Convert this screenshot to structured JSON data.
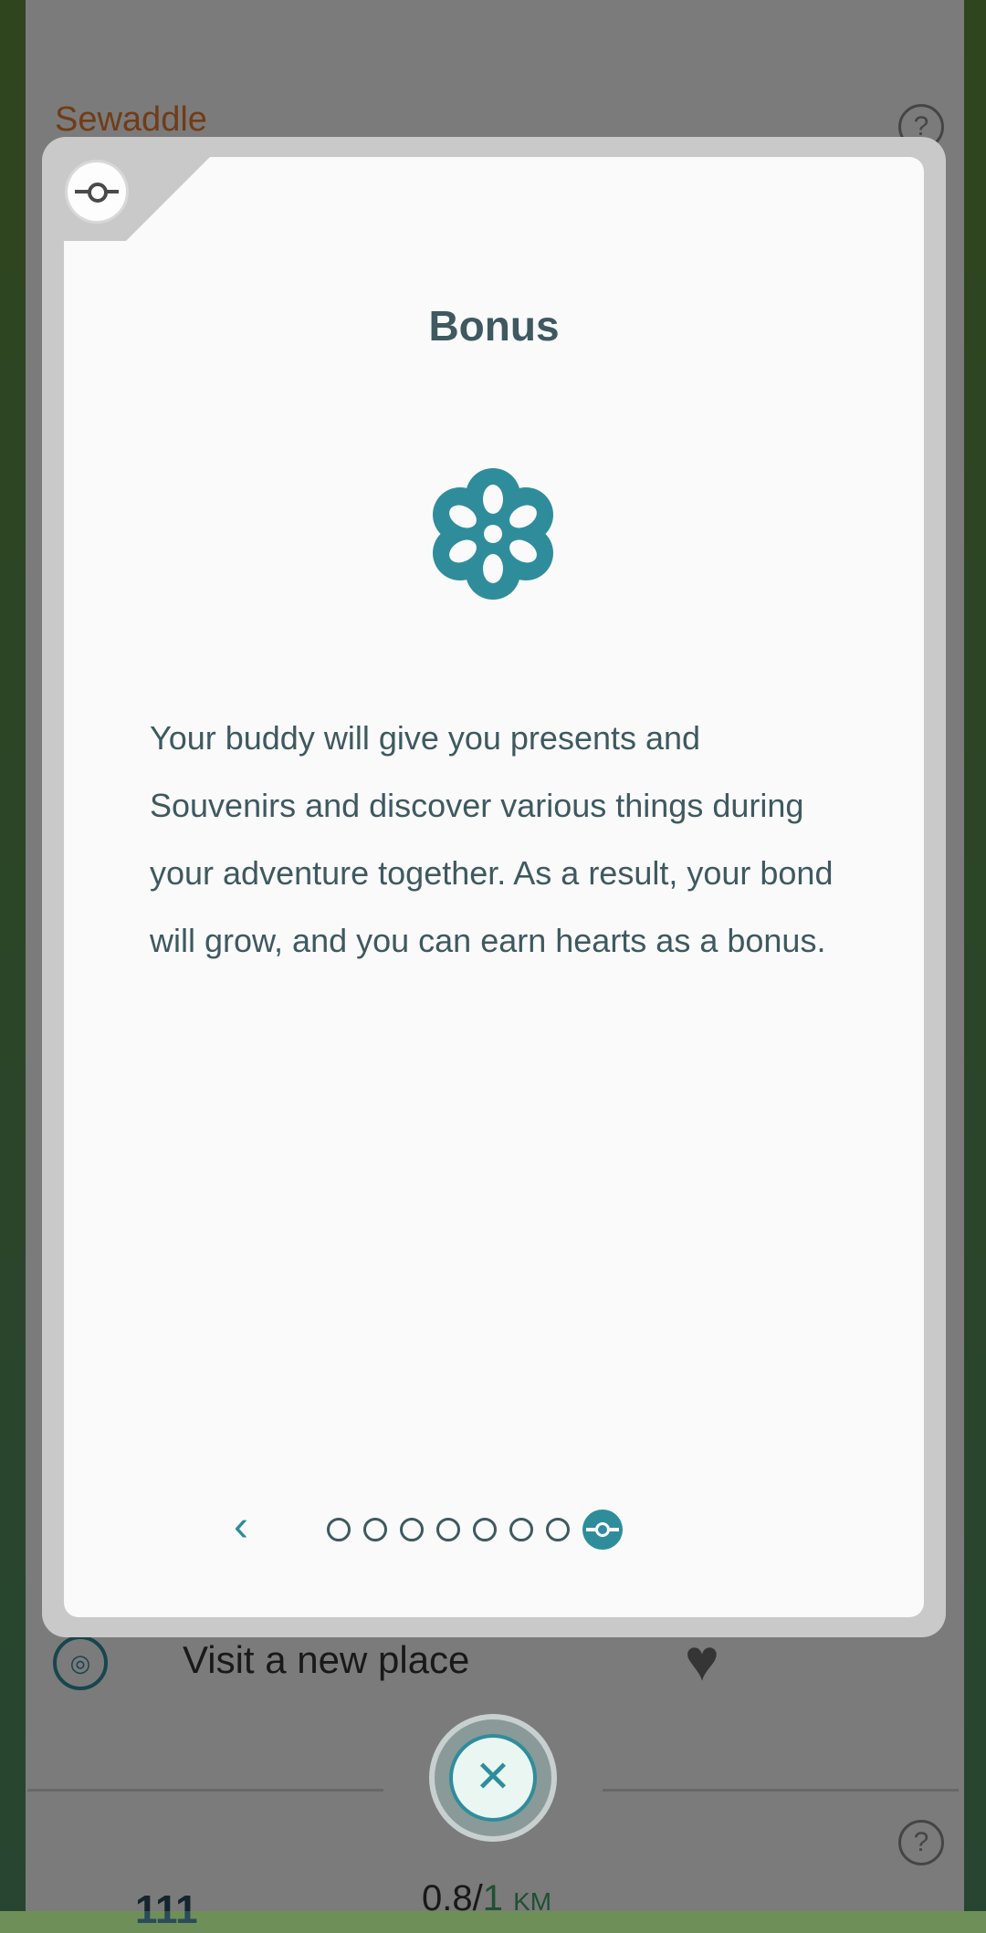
{
  "background": {
    "pokemon_name": "Sewaddle",
    "help_glyph": "?",
    "row_label": "Visit a new place",
    "heart_glyph": "♥",
    "row_icon_glyph": "◎",
    "distance_left": "111",
    "distance_walked": "0.8",
    "distance_slash": "/",
    "distance_goal": "1",
    "distance_unit": "KM"
  },
  "modal": {
    "title": "Bonus",
    "body": "Your buddy will give you presents and Souvenirs and discover various things during your adventure together. As a result, your bond will grow, and you can earn hearts as a bonus.",
    "prev_glyph": "‹",
    "close_glyph": "✕",
    "pager": {
      "total": 8,
      "current": 8
    }
  },
  "colors": {
    "accent": "#2f8d9b",
    "text": "#3e5960"
  }
}
